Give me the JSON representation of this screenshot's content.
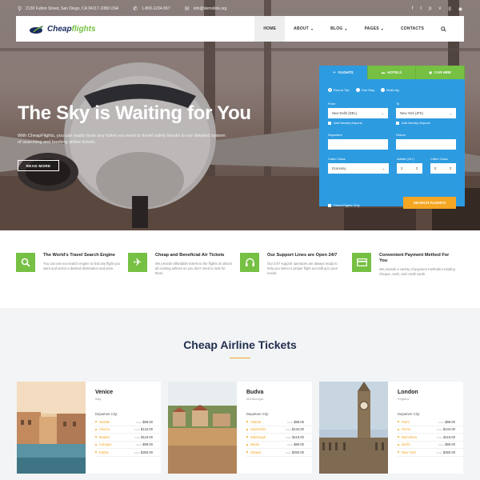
{
  "topbar": {
    "address": "2130 Fulton Street, San Diego, CA 94117-1080 USA",
    "phone": "1-800-1234-567",
    "email": "info@demolink.org"
  },
  "nav": {
    "logo_main": "Cheap",
    "logo_accent": "flights",
    "items": [
      {
        "label": "HOME",
        "caret": false
      },
      {
        "label": "ABOUT",
        "caret": true
      },
      {
        "label": "BLOG",
        "caret": true
      },
      {
        "label": "PAGES",
        "caret": true
      },
      {
        "label": "CONTACTS",
        "caret": false
      }
    ]
  },
  "hero": {
    "title": "The Sky is Waiting for You",
    "subtitle": "With CheapFlights, you can easily book any ticket you need to travel safely thanks to our detailed system of searching and booking airline tickets.",
    "button": "READ MORE"
  },
  "booking": {
    "tabs": [
      "FLIGHTS",
      "HOTELS",
      "CAR HIRE"
    ],
    "trip_types": [
      "Round Trip",
      "One Way",
      "Multi-city"
    ],
    "from_label": "From",
    "from_value": "New Delhi (DEL)",
    "to_label": "To",
    "to_value": "New York (JFK)",
    "nearby": "Add Nearby Airports",
    "departure_label": "Departure",
    "return_label": "Return",
    "cabin_label": "Cabin Class",
    "cabin_value": "Economy",
    "adults_label": "Adults (16+)",
    "adults_value": "2",
    "children_label": "Cabin Class",
    "children_value": "0",
    "direct": "Direct Flights Only",
    "search_button": "SEARCH FLIGHTS"
  },
  "features": [
    {
      "title": "The World's Travel Search Engine",
      "desc": "You can use our search engine to find any flight you want and select a desired destination and price."
    },
    {
      "title": "Cheap and Beneficial Air Tickets",
      "desc": "We provide affordable tickets to the flights of almost all existing airlines so you don't need to look for them."
    },
    {
      "title": "Our Support Lines are Open 24/7",
      "desc": "Our 24/7 support operators are always ready to help you select a proper flight according to your needs."
    },
    {
      "title": "Convenient Payment Method For You",
      "desc": "We provide a variety of payment methods including cheque, cash, and credit cards."
    }
  ],
  "tickets": {
    "title": "Cheap Airline Tickets",
    "from_prefix": "From",
    "cards": [
      {
        "city": "Venice",
        "country": "Italy",
        "dep_label": "Departure City:",
        "rows": [
          {
            "city": "Seattle",
            "price": "$98.00"
          },
          {
            "city": "Vienna",
            "price": "$134.00"
          },
          {
            "city": "Madrid",
            "price": "$119.00"
          },
          {
            "city": "Cologne",
            "price": "$99.00"
          },
          {
            "city": "Dallas",
            "price": "$350.00"
          }
        ]
      },
      {
        "city": "Budva",
        "country": "Montenegro",
        "dep_label": "Departure City:",
        "rows": [
          {
            "city": "Atlanta",
            "price": "$98.00"
          },
          {
            "city": "Stockholm",
            "price": "$134.00"
          },
          {
            "city": "Edinburgh",
            "price": "$119.00"
          },
          {
            "city": "Miami",
            "price": "$99.00"
          },
          {
            "city": "Ottawa",
            "price": "$350.00"
          }
        ]
      },
      {
        "city": "London",
        "country": "England",
        "dep_label": "Departure City:",
        "rows": [
          {
            "city": "Paris",
            "price": "$98.00"
          },
          {
            "city": "Rome",
            "price": "$134.00"
          },
          {
            "city": "Barcelona",
            "price": "$119.00"
          },
          {
            "city": "Berlin",
            "price": "$99.00"
          },
          {
            "city": "New York",
            "price": "$350.00"
          }
        ]
      }
    ]
  },
  "colors": {
    "green": "#76c043",
    "blue": "#2d9be0",
    "orange": "#f5a623",
    "navy": "#1f2d4d"
  }
}
